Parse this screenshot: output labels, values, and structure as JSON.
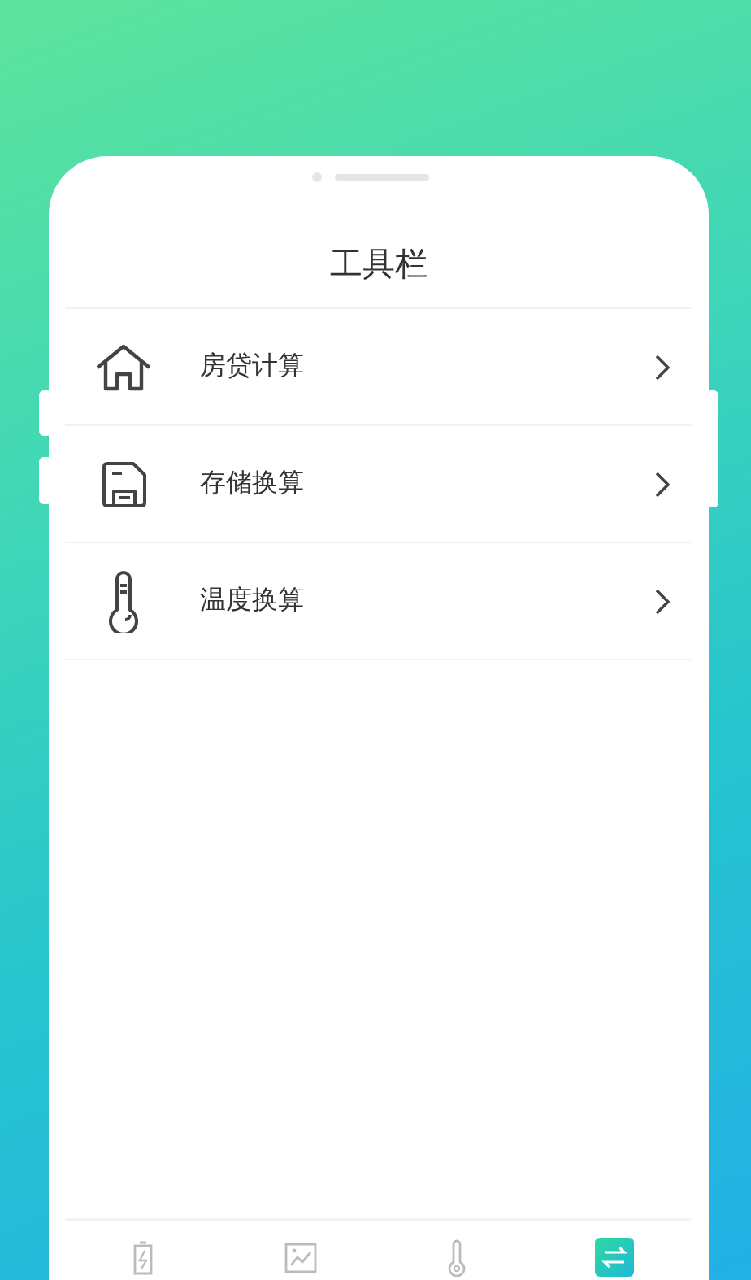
{
  "title": "工具栏",
  "menu": [
    {
      "kind": "house",
      "label": "房贷计算"
    },
    {
      "kind": "disk",
      "label": "存储换算"
    },
    {
      "kind": "thermometer",
      "label": "温度换算"
    }
  ],
  "tab_bar": [
    {
      "kind": "battery",
      "selected": false
    },
    {
      "kind": "chart",
      "selected": false
    },
    {
      "kind": "thermometer",
      "selected": false
    },
    {
      "kind": "convert",
      "selected": true
    }
  ]
}
